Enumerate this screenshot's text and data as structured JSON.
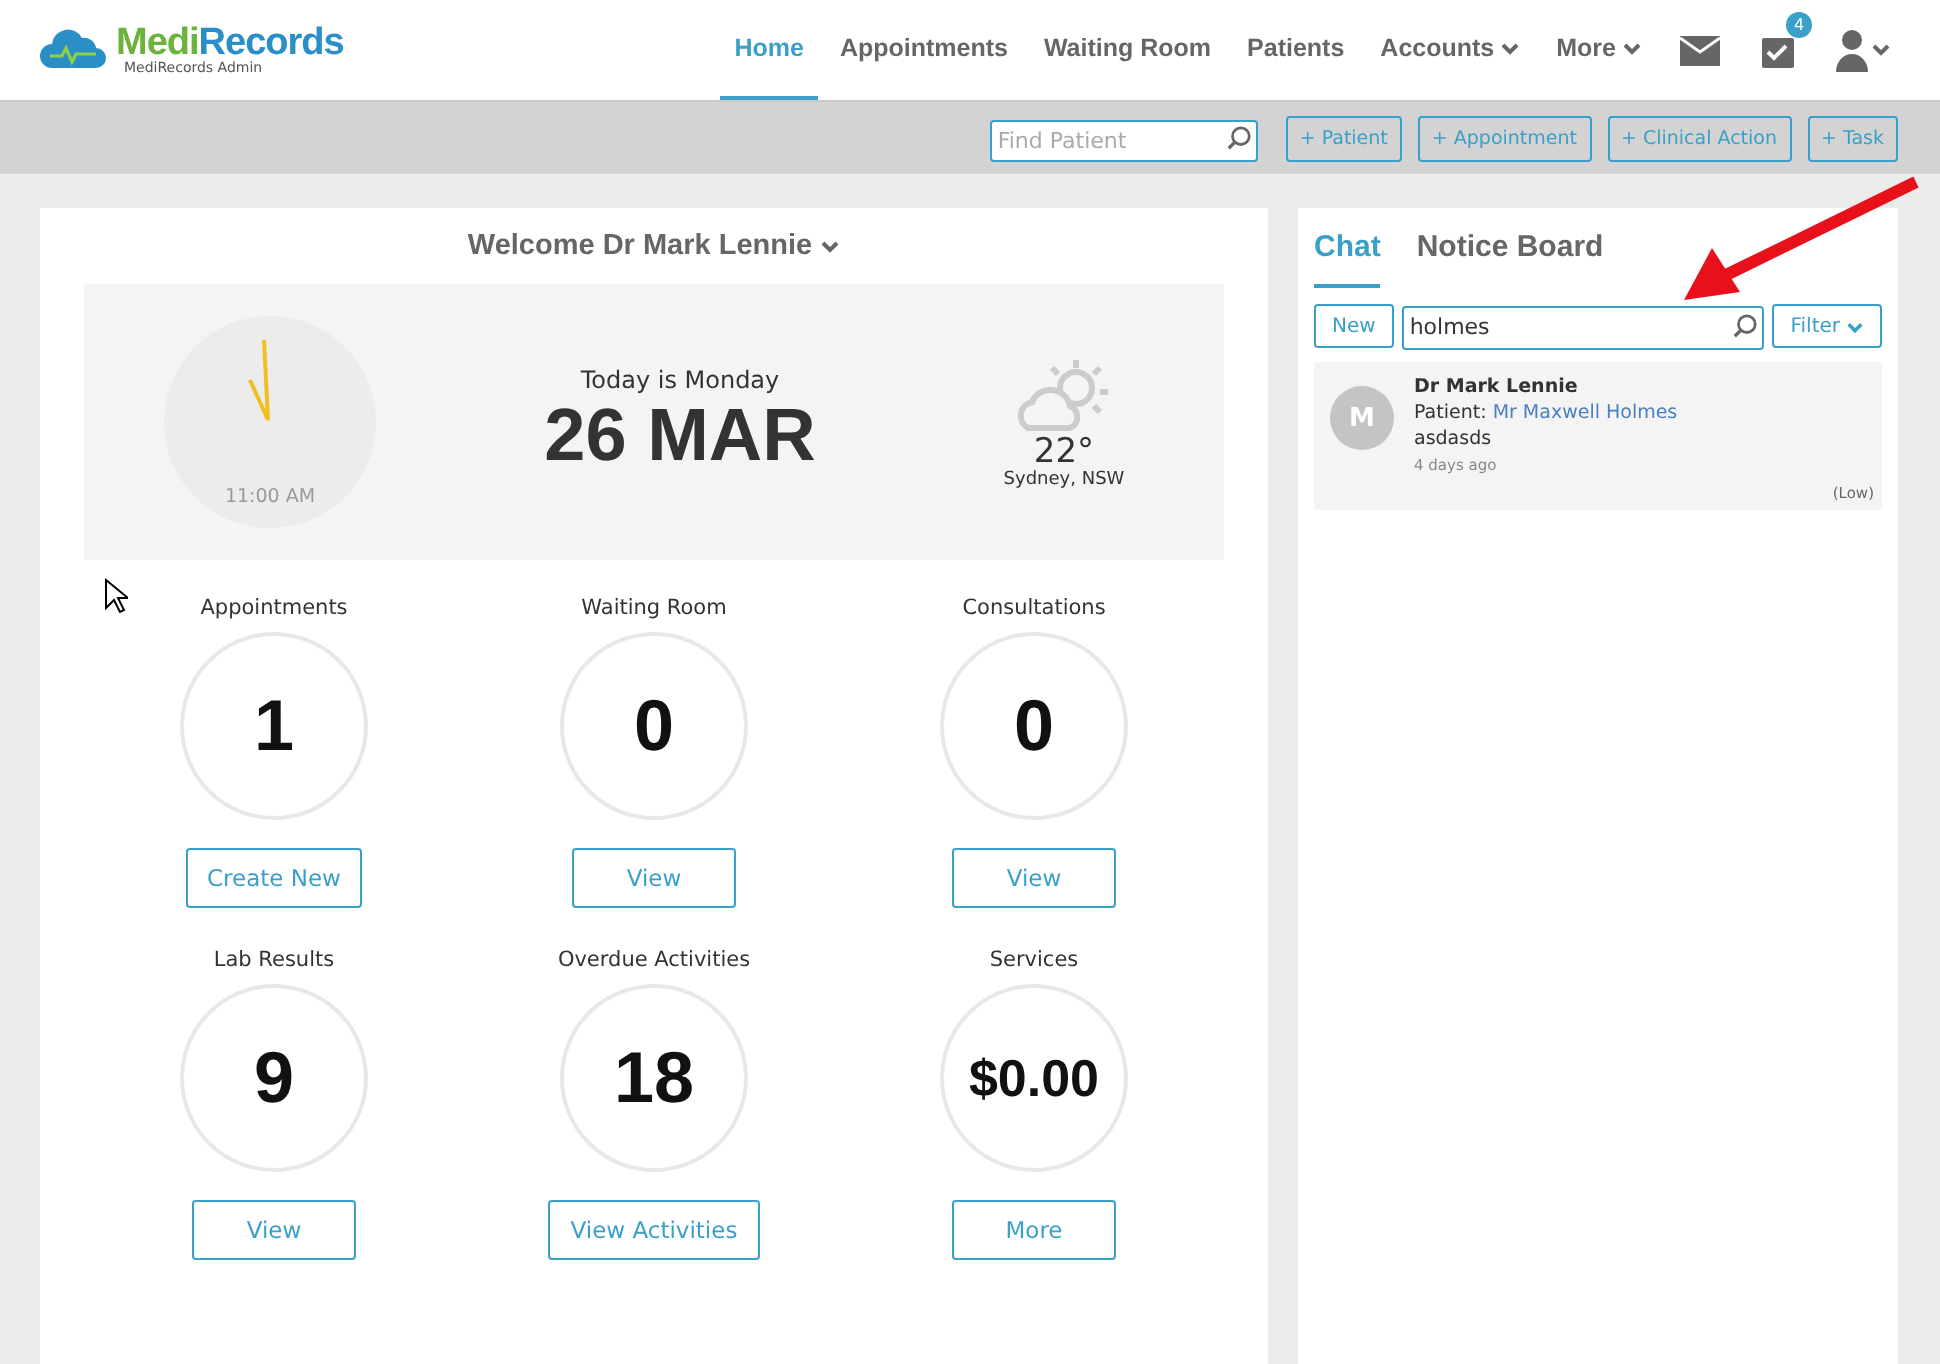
{
  "brand": {
    "name_first": "Medi",
    "name_second": "Records",
    "subtitle": "MediRecords Admin"
  },
  "nav": [
    {
      "label": "Home",
      "selected": true,
      "dropdown": false
    },
    {
      "label": "Appointments",
      "selected": false,
      "dropdown": false
    },
    {
      "label": "Waiting Room",
      "selected": false,
      "dropdown": false
    },
    {
      "label": "Patients",
      "selected": false,
      "dropdown": false
    },
    {
      "label": "Accounts",
      "selected": false,
      "dropdown": true
    },
    {
      "label": "More",
      "selected": false,
      "dropdown": true
    }
  ],
  "tasks_badge": "4",
  "toolbar": {
    "search": {
      "placeholder": "Find Patient"
    },
    "buttons": [
      "+ Patient",
      "+ Appointment",
      "+ Clinical Action",
      "+ Task"
    ]
  },
  "welcome": "Welcome Dr Mark Lennie",
  "today": {
    "time": "11:00 AM",
    "day_label": "Today is Monday",
    "date": "26 MAR",
    "temperature": "22°",
    "location": "Sydney, NSW"
  },
  "stats": [
    {
      "title": "Appointments",
      "value": "1",
      "action": "Create New"
    },
    {
      "title": "Waiting Room",
      "value": "0",
      "action": "View"
    },
    {
      "title": "Consultations",
      "value": "0",
      "action": "View"
    },
    {
      "title": "Lab Results",
      "value": "9",
      "action": "View"
    },
    {
      "title": "Overdue Activities",
      "value": "18",
      "action": "View Activities"
    },
    {
      "title": "Services",
      "value": "$0.00",
      "action": "More"
    }
  ],
  "side_tabs": [
    {
      "label": "Chat",
      "selected": true
    },
    {
      "label": "Notice Board",
      "selected": false
    }
  ],
  "chat_controls": {
    "new_button": "New",
    "search_value": "holmes",
    "filter_button": "Filter"
  },
  "messages": [
    {
      "initial": "M",
      "author": "Dr Mark Lennie",
      "patient_label": "Patient:",
      "patient": "Mr Maxwell Holmes",
      "text": "asdasds",
      "time": "4 days ago",
      "priority": "(Low)"
    }
  ]
}
